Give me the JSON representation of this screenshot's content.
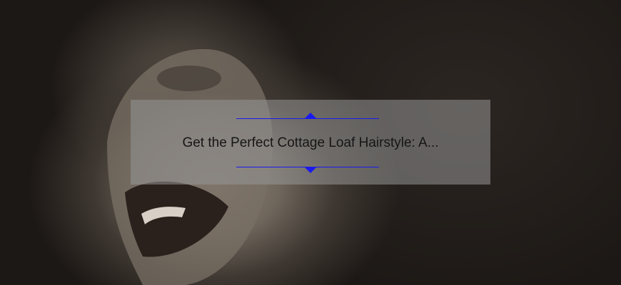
{
  "hero": {
    "background_image": "woman-laughing-photo",
    "accent_color": "#1a1aee"
  },
  "overlay": {
    "title": "Get the Perfect Cottage Loaf Hairstyle: A..."
  }
}
